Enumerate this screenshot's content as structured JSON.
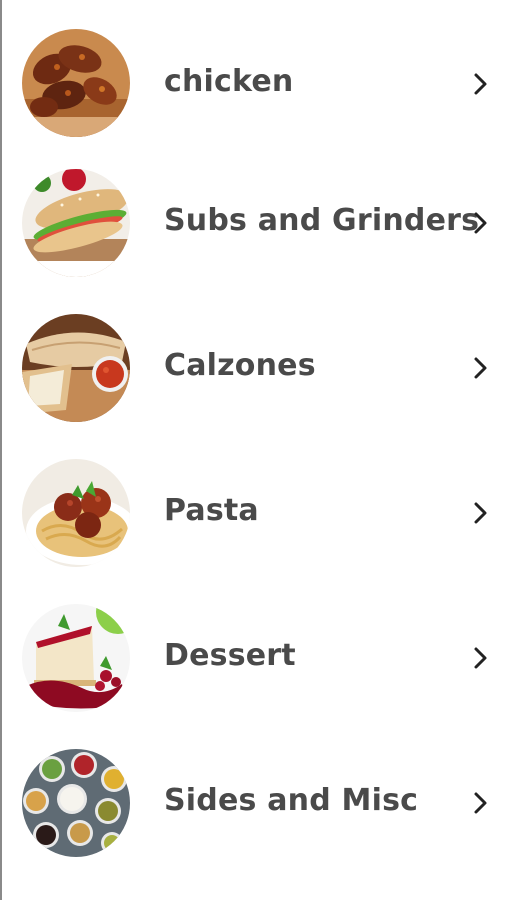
{
  "menu": {
    "categories": [
      {
        "label": "chicken",
        "icon": "chicken-wings-photo"
      },
      {
        "label": "Subs and Grinders",
        "icon": "sub-sandwich-photo"
      },
      {
        "label": "Calzones",
        "icon": "calzone-photo"
      },
      {
        "label": "Pasta",
        "icon": "spaghetti-meatballs-photo"
      },
      {
        "label": "Dessert",
        "icon": "cheesecake-photo"
      },
      {
        "label": "Sides and Misc",
        "icon": "sauces-and-sides-photo"
      }
    ]
  },
  "colors": {
    "background": "#ffffff",
    "label_text": "#4a4a4a",
    "chevron": "#222222"
  }
}
